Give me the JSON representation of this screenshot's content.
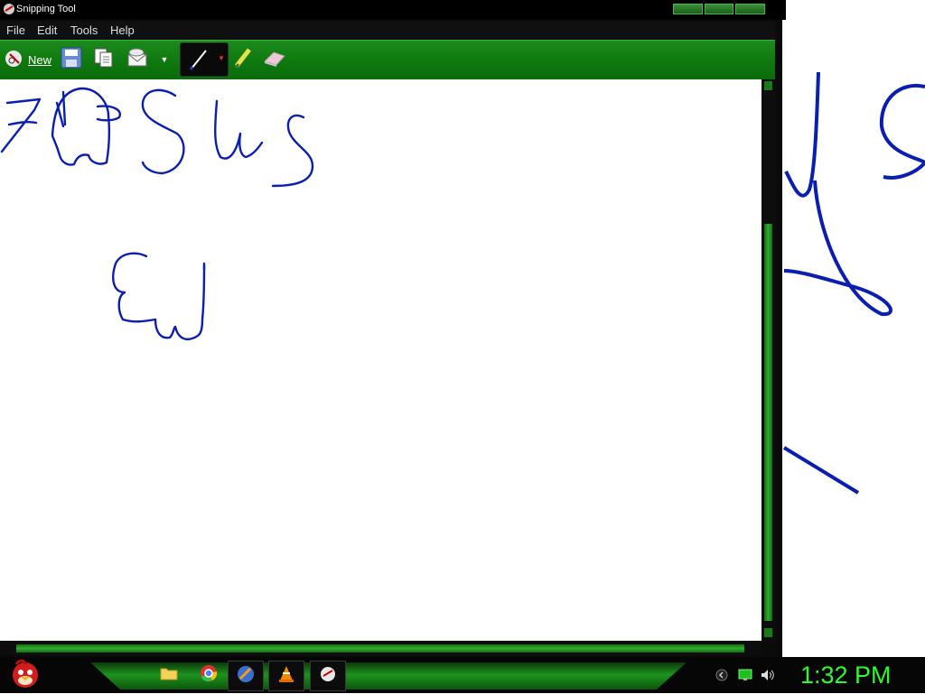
{
  "window": {
    "title": "Snipping Tool"
  },
  "menu": {
    "file": "File",
    "edit": "Edit",
    "tools": "Tools",
    "help": "Help"
  },
  "toolbar": {
    "new_label": "New",
    "icons": [
      "scissors-icon",
      "save-icon",
      "copy-icon",
      "send-email-icon",
      "dropdown-arrow-icon",
      "pen-icon",
      "highlighter-icon",
      "eraser-icon"
    ]
  },
  "colors": {
    "ink": "#0a1fb0",
    "accent_green": "#0f7a0f",
    "clock_green": "#2dfa2d"
  },
  "taskbar": {
    "icons": [
      "start-orb-angry-bird-icon",
      "folder-icon",
      "chrome-icon",
      "app-icon",
      "vlc-icon",
      "snipping-tool-icon"
    ],
    "tray_icons": [
      "show-hidden-icon",
      "network-icon",
      "volume-icon"
    ],
    "clock": "1:32 PM"
  }
}
